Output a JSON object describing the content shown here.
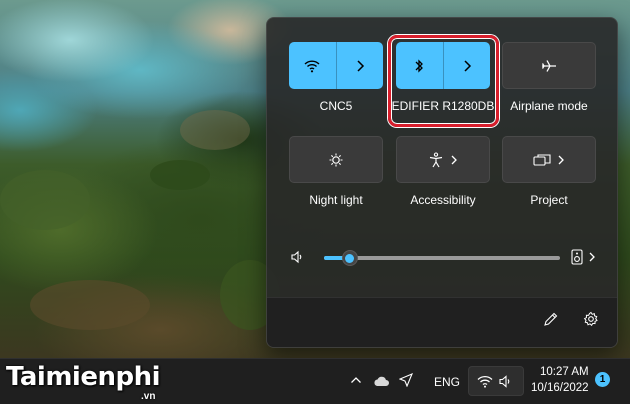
{
  "quick_settings": {
    "tiles": [
      {
        "label": "CNC5",
        "icon": "wifi-icon",
        "active": true
      },
      {
        "label": "EDIFIER R1280DB",
        "icon": "bluetooth-icon",
        "active": true
      },
      {
        "label": "Airplane mode",
        "icon": "airplane-icon",
        "active": false
      },
      {
        "label": "Night light",
        "icon": "night-light-icon",
        "active": false
      },
      {
        "label": "Accessibility",
        "icon": "accessibility-icon",
        "active": false
      },
      {
        "label": "Project",
        "icon": "project-icon",
        "active": false
      }
    ],
    "volume": {
      "level": 0.11
    }
  },
  "taskbar": {
    "language": "ENG",
    "time": "10:27 AM",
    "date": "10/16/2022",
    "notification_count": "1"
  },
  "watermark": {
    "brand": "Taimienphi",
    "suffix": ".vn"
  },
  "colors": {
    "accent": "#4cc2ff",
    "highlight": "#d81e2c",
    "panel": "#282828"
  }
}
